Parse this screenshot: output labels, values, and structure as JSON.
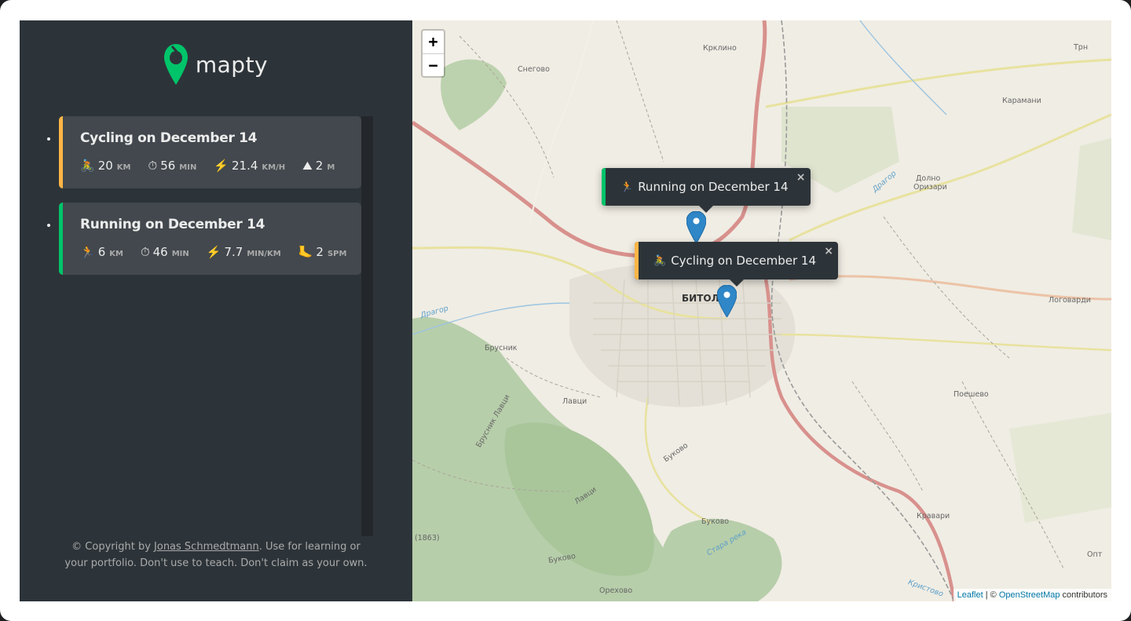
{
  "logo": {
    "text": "mapty",
    "icon": "map-pin-icon",
    "color": "#00c46a"
  },
  "workouts": [
    {
      "type": "cycling",
      "title": "Cycling on December 14",
      "color": "#ffb545",
      "details": [
        {
          "icon": "🚴",
          "value": "20",
          "unit": "km"
        },
        {
          "icon": "⏱",
          "value": "56",
          "unit": "min"
        },
        {
          "icon": "⚡️",
          "value": "21.4",
          "unit": "km/h"
        },
        {
          "icon": "⛰",
          "value": "2",
          "unit": "m"
        }
      ]
    },
    {
      "type": "running",
      "title": "Running on December 14",
      "color": "#00c46a",
      "details": [
        {
          "icon": "🏃",
          "value": "6",
          "unit": "km"
        },
        {
          "icon": "⏱",
          "value": "46",
          "unit": "min"
        },
        {
          "icon": "⚡️",
          "value": "7.7",
          "unit": "min/km"
        },
        {
          "icon": "🦶",
          "value": "2",
          "unit": "spm"
        }
      ]
    }
  ],
  "copyright": {
    "prefix": "© Copyright by ",
    "author": "Jonas Schmedtmann",
    "suffix": ". Use for learning or your portfolio. Don't use to teach. Don't claim as your own."
  },
  "map": {
    "zoom_in": "+",
    "zoom_out": "−",
    "popups": [
      {
        "type": "running",
        "icon": "🏃",
        "text": "Running on December 14",
        "close": "×"
      },
      {
        "type": "cycling",
        "icon": "🚴",
        "text": "Cycling on December 14",
        "close": "×"
      }
    ],
    "attribution": {
      "leaflet": "Leaflet",
      "sep": " | © ",
      "osm": "OpenStreetMap",
      "suffix": " contributors"
    },
    "places": {
      "krklino": "Крклино",
      "snegovo": "Снегово",
      "karamani": "Карамани",
      "dolno_orizari_1": "Долно",
      "dolno_orizari_2": "Оризари",
      "bitola": "БИТОЛ",
      "brusnik": "Брусник",
      "lavci": "Лавци",
      "bukovo": "Буково",
      "bukovo2": "Буково",
      "bukovo3": "Буково",
      "poshevo": "Поешево",
      "logovardi": "Логоварди",
      "kravari": "Кравари",
      "orehovo": "Орехово",
      "trn": "Трн",
      "elev": "(1863)",
      "dragor1": "Драгор",
      "dragor2": "Драгор",
      "brusnik_lavci": "Брусник Лавци",
      "lavci2": "Лавци",
      "opt": "Опт",
      "kristovo": "Кристово",
      "stara_reka": "Стара река"
    }
  }
}
